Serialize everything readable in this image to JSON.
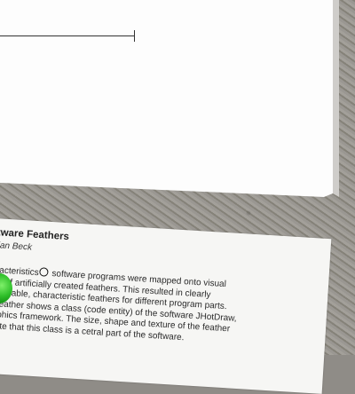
{
  "card": {
    "title": "ftware Feathers",
    "author": "bian Beck",
    "body_lines": [
      "aracteristics",
      " software programs were mapped onto visual",
      "tes of artificially created feathers. This resulted in clearly",
      "guishable, characteristic feathers for different program parts.",
      "s feather shows a class (code entity) of the software JHotDraw,",
      "raphics framework. The size, shape and texture of the feather",
      "icate that this class is a cetral part of the software."
    ]
  },
  "colors": {
    "wall": "#8f8c87",
    "panel": "#fdfdfd",
    "card": "#f6f6f4",
    "accent_green": "#2fbf2a"
  }
}
